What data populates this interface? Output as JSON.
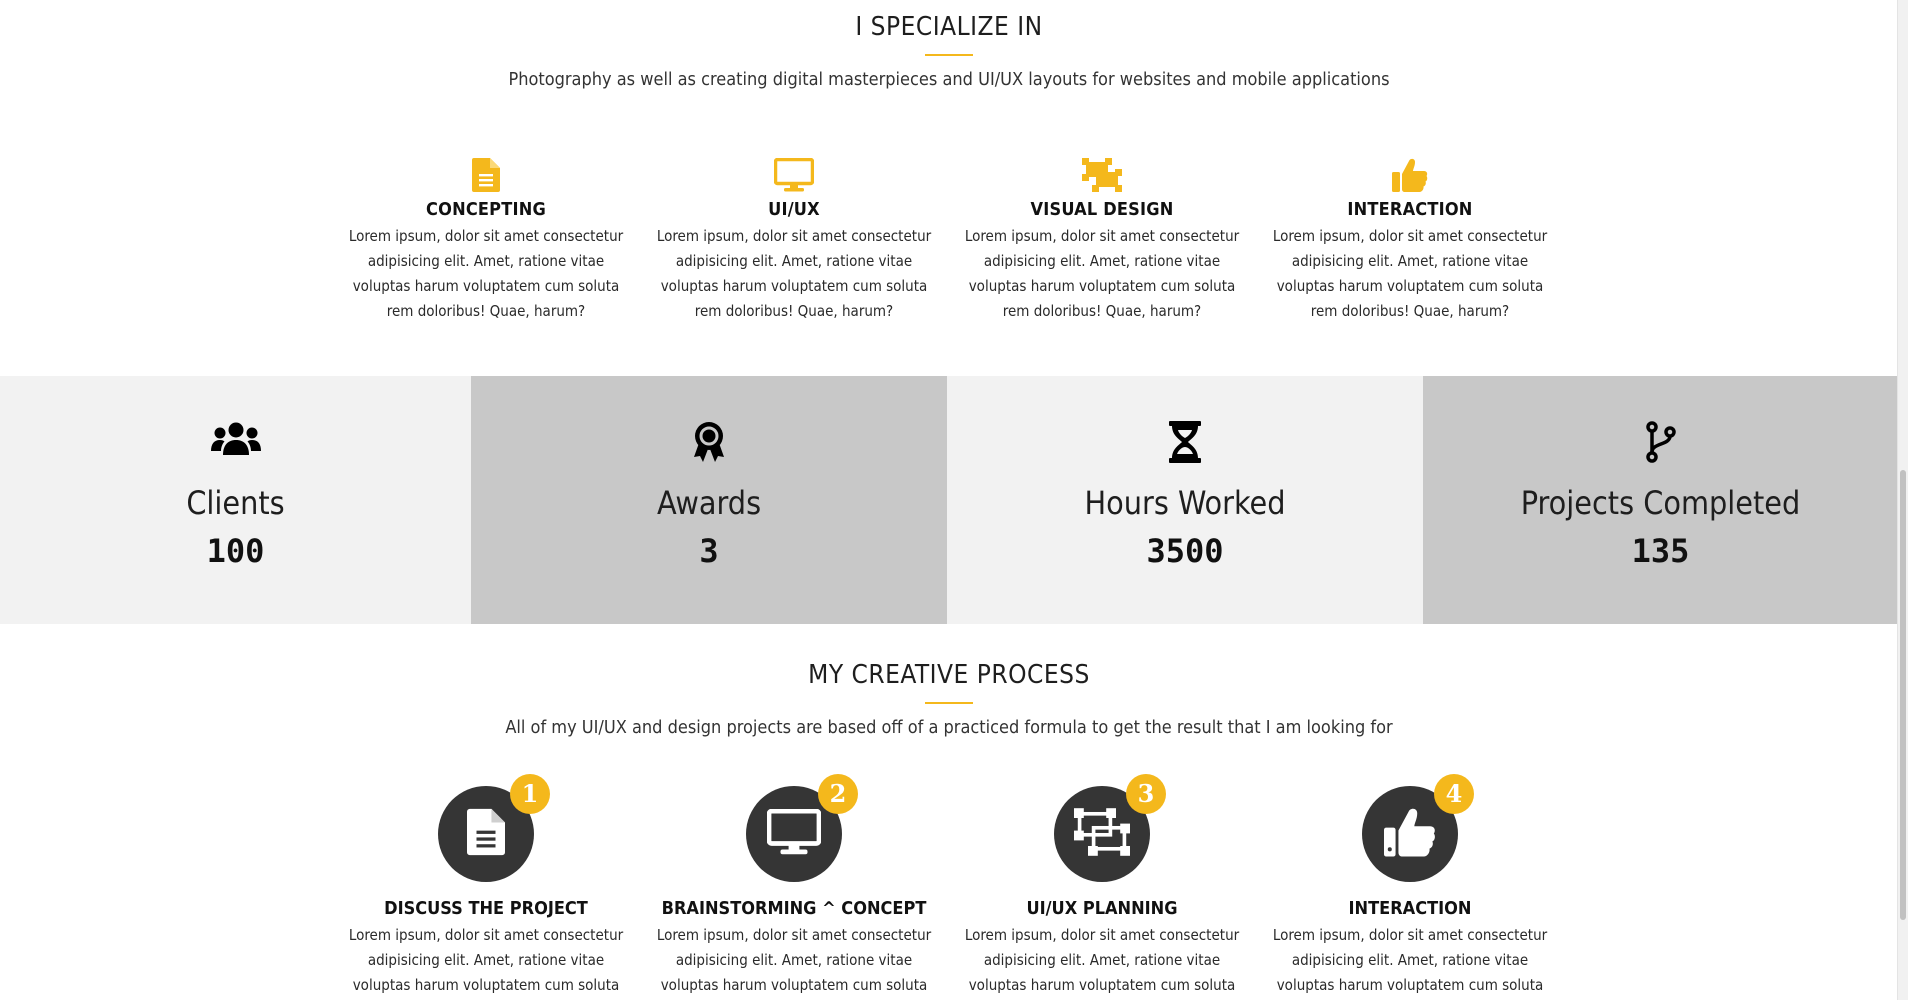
{
  "specialize": {
    "title": "I SPECIALIZE IN",
    "subtitle": "Photography as well as creating digital masterpieces and UI/UX layouts for websites and mobile applications",
    "accent_color": "#f4b81c",
    "items": [
      {
        "icon": "document-icon",
        "heading": "CONCEPTING",
        "text": "Lorem ipsum, dolor sit amet consectetur adipisicing elit. Amet, ratione vitae voluptas harum voluptatem cum soluta rem doloribus! Quae, harum?"
      },
      {
        "icon": "monitor-icon",
        "heading": "UI/UX",
        "text": "Lorem ipsum, dolor sit amet consectetur adipisicing elit. Amet, ratione vitae voluptas harum voluptatem cum soluta rem doloribus! Quae, harum?"
      },
      {
        "icon": "object-ungroup-icon",
        "heading": "VISUAL DESIGN",
        "text": "Lorem ipsum, dolor sit amet consectetur adipisicing elit. Amet, ratione vitae voluptas harum voluptatem cum soluta rem doloribus! Quae, harum?"
      },
      {
        "icon": "thumbs-up-icon",
        "heading": "INTERACTION",
        "text": "Lorem ipsum, dolor sit amet consectetur adipisicing elit. Amet, ratione vitae voluptas harum voluptatem cum soluta rem doloribus! Quae, harum?"
      }
    ]
  },
  "stats": [
    {
      "icon": "users-icon",
      "label": "Clients",
      "value": "100"
    },
    {
      "icon": "award-icon",
      "label": "Awards",
      "value": "3"
    },
    {
      "icon": "hourglass-icon",
      "label": "Hours Worked",
      "value": "3500"
    },
    {
      "icon": "code-branch-icon",
      "label": "Projects Completed",
      "value": "135"
    }
  ],
  "process": {
    "title": "MY CREATIVE PROCESS",
    "subtitle": "All of my UI/UX and design projects are based off of a practiced formula to get the result that I am looking for",
    "items": [
      {
        "number": "1",
        "icon": "document-icon",
        "heading": "DISCUSS THE PROJECT",
        "text": "Lorem ipsum, dolor sit amet consectetur adipisicing elit. Amet, ratione vitae voluptas harum voluptatem cum soluta rem doloribus!"
      },
      {
        "number": "2",
        "icon": "monitor-icon",
        "heading": "BRAINSTORMING ^ CONCEPT",
        "text": "Lorem ipsum, dolor sit amet consectetur adipisicing elit. Amet, ratione vitae voluptas harum voluptatem cum soluta rem doloribus!"
      },
      {
        "number": "3",
        "icon": "object-ungroup-icon",
        "heading": "UI/UX PLANNING",
        "text": "Lorem ipsum, dolor sit amet consectetur adipisicing elit. Amet, ratione vitae voluptas harum voluptatem cum soluta rem doloribus!"
      },
      {
        "number": "4",
        "icon": "thumbs-up-icon",
        "heading": "INTERACTION",
        "text": "Lorem ipsum, dolor sit amet consectetur adipisicing elit. Amet, ratione vitae voluptas harum voluptatem cum soluta rem doloribus!"
      }
    ]
  }
}
